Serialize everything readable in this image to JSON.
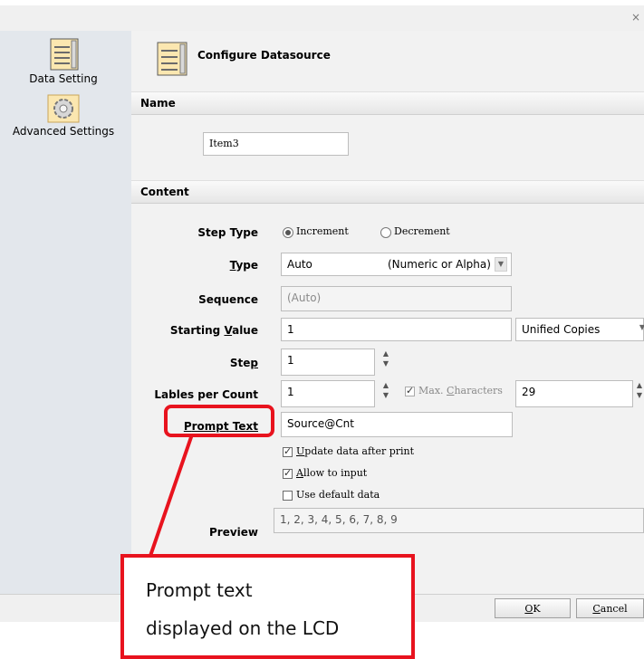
{
  "window": {
    "close_glyph": "×"
  },
  "sidebar": {
    "items": [
      {
        "label": "Data Setting",
        "icon": "data-sheet-icon"
      },
      {
        "label": "Advanced Settings",
        "icon": "gear-icon"
      }
    ]
  },
  "header": {
    "title": "Configure Datasource"
  },
  "name_section": {
    "title": "Name",
    "value": "Item3"
  },
  "content_section": {
    "title": "Content"
  },
  "form": {
    "step_type": {
      "label": "Step Type",
      "options": [
        "Increment",
        "Decrement"
      ],
      "selected": "Increment"
    },
    "type": {
      "label_pre": "",
      "label_u": "T",
      "label_post": "ype",
      "value": "Auto",
      "hint": "(Numeric or Alpha)"
    },
    "sequence": {
      "label": "Sequence",
      "placeholder": "(Auto)"
    },
    "starting_value": {
      "label_pre": "Starting ",
      "label_u": "V",
      "label_post": "alue",
      "value": "1",
      "copies": "Unified Copies"
    },
    "step": {
      "label_pre": "Ste",
      "label_u": "p",
      "label_post": "",
      "value": "1"
    },
    "labels_per_count": {
      "label": "Lables per Count",
      "value": "1"
    },
    "max_characters": {
      "label_pre": "Max. ",
      "label_u": "C",
      "label_post": "haracters",
      "checked": true,
      "value": "29"
    },
    "prompt_text": {
      "label_pre": "",
      "label_u": "P",
      "label_post": "rompt Text",
      "value": "Source@Cnt"
    },
    "checks": [
      {
        "pre": "",
        "u": "U",
        "post": "pdate data after print",
        "checked": true
      },
      {
        "pre": "",
        "u": "A",
        "post": "llow to input",
        "checked": true
      },
      {
        "pre": "",
        "u": "",
        "post": "Use default data",
        "checked": false
      }
    ],
    "preview": {
      "label": "Preview",
      "value": "1, 2, 3, 4, 5, 6, 7, 8, 9"
    }
  },
  "footer": {
    "ok": {
      "pre": "",
      "u": "O",
      "post": "K"
    },
    "cancel": {
      "pre": "",
      "u": "C",
      "post": "ancel"
    }
  },
  "callout": {
    "line1": "Prompt text",
    "line2": "displayed on the LCD"
  },
  "colors": {
    "callout_red": "#e8131e"
  }
}
